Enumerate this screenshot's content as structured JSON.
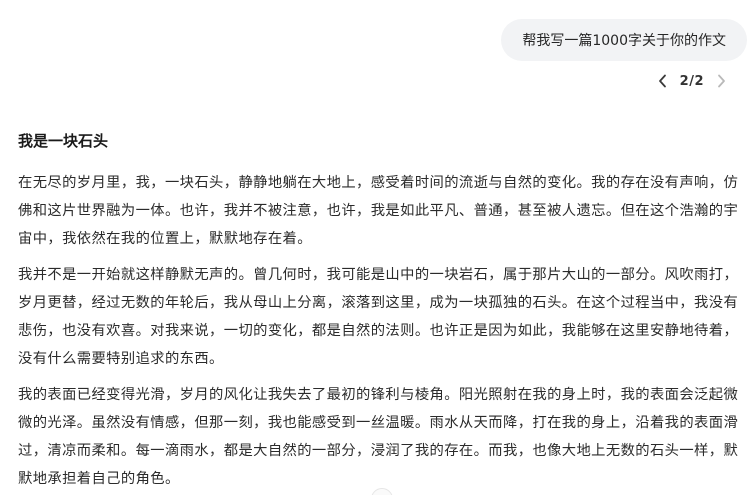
{
  "user_message": "帮我写一篇1000字关于你的作文",
  "pager": {
    "current_total": "2/2",
    "prev_icon": "chevron-left-icon",
    "next_icon": "chevron-right-icon"
  },
  "answer": {
    "title": "我是一块石头",
    "paragraphs": [
      "在无尽的岁月里，我，一块石头，静静地躺在大地上，感受着时间的流逝与自然的变化。我的存在没有声响，仿佛和这片世界融为一体。也许，我并不被注意，也许，我是如此平凡、普通，甚至被人遗忘。但在这个浩瀚的宇宙中，我依然在我的位置上，默默地存在着。",
      "我并不是一开始就这样静默无声的。曾几何时，我可能是山中的一块岩石，属于那片大山的一部分。风吹雨打，岁月更替，经过无数的年轮后，我从母山上分离，滚落到这里，成为一块孤独的石头。在这个过程当中，我没有悲伤，也没有欢喜。对我来说，一切的变化，都是自然的法则。也许正是因为如此，我能够在这里安静地待着，没有什么需要特别追求的东西。",
      "我的表面已经变得光滑，岁月的风化让我失去了最初的锋利与棱角。阳光照射在我的身上时，我的表面会泛起微微的光泽。虽然没有情感，但那一刻，我也能感受到一丝温暖。雨水从天而降，打在我的身上，沿着我的表面滑过，清凉而柔和。每一滴雨水，都是大自然的一部分，浸润了我的存在。而我，也像大地上无数的石头一样，默默地承担着自己的角色。"
    ]
  }
}
